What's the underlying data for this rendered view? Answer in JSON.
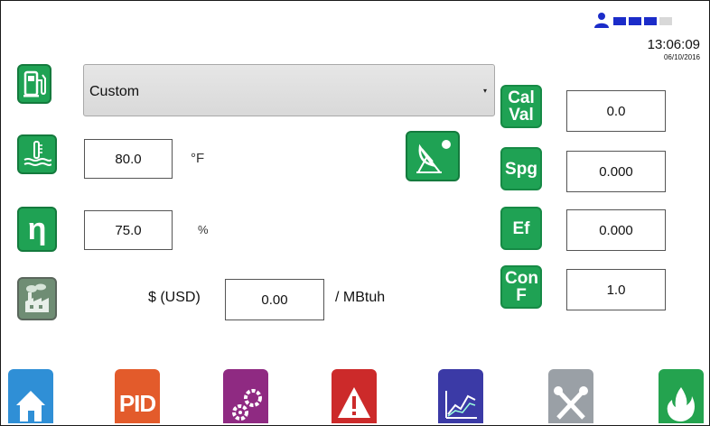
{
  "status": {
    "time": "13:06:09",
    "date": "06/10/2016",
    "signal_bars": [
      true,
      true,
      true,
      false
    ],
    "colors": {
      "user": "#1b2cc9",
      "bar": "#1b2cc9"
    }
  },
  "fuel": {
    "selected": "Custom",
    "icon": "fuel-pump-icon"
  },
  "temperature": {
    "value": "80.0",
    "unit": "°F",
    "icon": "thermometer-water-icon"
  },
  "efficiency": {
    "value": "75.0",
    "unit": "%",
    "icon": "eta-icon",
    "glyph": "η"
  },
  "cost": {
    "currency_label": "$ (USD)",
    "value": "0.00",
    "per_label": "/ MBtuh",
    "icon": "factory-icon"
  },
  "satellite_button": {
    "icon": "satellite-dish-icon"
  },
  "parameters": [
    {
      "label": "Cal Val",
      "value": "0.0"
    },
    {
      "label": "Spg",
      "value": "0.000"
    },
    {
      "label": "Ef",
      "value": "0.000"
    },
    {
      "label": "Con F",
      "value": "1.0"
    }
  ],
  "nav": [
    {
      "name": "home",
      "icon": "home-icon",
      "color": "#2f8fd6"
    },
    {
      "name": "pid",
      "icon": "pid-icon",
      "label": "PID",
      "color": "#e35b2b"
    },
    {
      "name": "settings",
      "icon": "gears-icon",
      "color": "#8f2a82"
    },
    {
      "name": "alarm",
      "icon": "warning-icon",
      "color": "#cc2a2a"
    },
    {
      "name": "trend",
      "icon": "chart-icon",
      "color": "#3b3aa6"
    },
    {
      "name": "tools",
      "icon": "tools-icon",
      "color": "#9aa0a6"
    },
    {
      "name": "combustion",
      "icon": "flame-icon",
      "color": "#24a34f"
    }
  ],
  "accent": "#1fa254"
}
